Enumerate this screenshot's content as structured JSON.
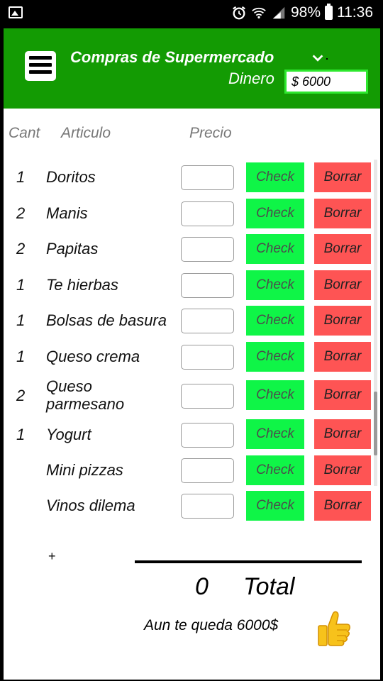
{
  "status_bar": {
    "battery": "98%",
    "time": "11:36",
    "icons": [
      "gallery-icon",
      "alarm-icon",
      "wifi-icon",
      "signal-icon",
      "battery-icon"
    ]
  },
  "header": {
    "title": "Compras de Supermercado",
    "money_label": "Dinero",
    "money_value": "$ 6000",
    "color": "#139b03"
  },
  "columns": {
    "qty": "Cant",
    "item": "Articulo",
    "price": "Precio"
  },
  "items": [
    {
      "qty": "1",
      "name": "Doritos",
      "check": "Check",
      "delete": "Borrar"
    },
    {
      "qty": "2",
      "name": "Manis",
      "check": "Check",
      "delete": "Borrar"
    },
    {
      "qty": "2",
      "name": "Papitas",
      "check": "Check",
      "delete": "Borrar"
    },
    {
      "qty": "1",
      "name": "Te hierbas",
      "check": "Check",
      "delete": "Borrar"
    },
    {
      "qty": "1",
      "name": "Bolsas de basura",
      "check": "Check",
      "delete": "Borrar"
    },
    {
      "qty": "1",
      "name": "Queso crema",
      "check": "Check",
      "delete": "Borrar"
    },
    {
      "qty": "2",
      "name": "Queso parmesano",
      "check": "Check",
      "delete": "Borrar"
    },
    {
      "qty": "1",
      "name": "Yogurt",
      "check": "Check",
      "delete": "Borrar"
    },
    {
      "qty": "",
      "name": "Mini pizzas",
      "check": "Check",
      "delete": "Borrar"
    },
    {
      "qty": "",
      "name": "Vinos dilema",
      "check": "Check",
      "delete": "Borrar"
    }
  ],
  "footer": {
    "add": "+",
    "total_value": "0",
    "total_label": "Total",
    "remaining": "Aun te queda 6000$"
  },
  "colors": {
    "check": "#0ff547",
    "delete": "#fe5454"
  }
}
